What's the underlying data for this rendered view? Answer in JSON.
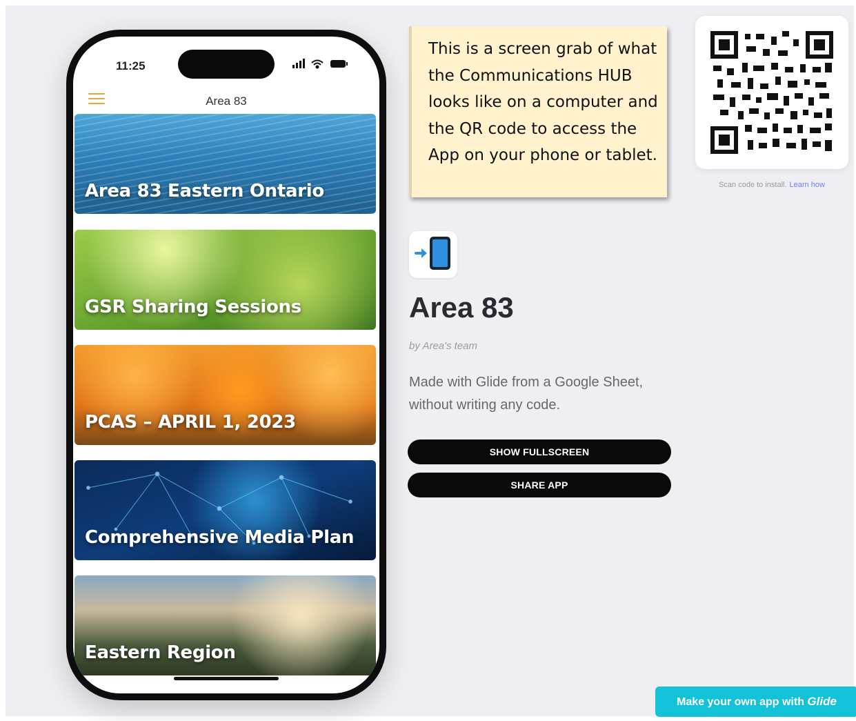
{
  "phone": {
    "status_time": "11:25",
    "header_title": "Area 83",
    "cards": [
      {
        "label": "Area 83 Eastern Ontario"
      },
      {
        "label": "GSR Sharing Sessions"
      },
      {
        "label": "PCAS – APRIL 1, 2023"
      },
      {
        "label": "Comprehensive Media Plan"
      },
      {
        "label": "Eastern Region"
      }
    ]
  },
  "note": {
    "text": "This is a screen grab of what the Communications HUB looks like on a computer and the QR code to access the App on your phone or tablet."
  },
  "qr": {
    "caption": "Scan code to install.",
    "link": "Learn how"
  },
  "app": {
    "title": "Area 83",
    "author": "by Area's team",
    "description": "Made with Glide from a Google Sheet, without writing any code.",
    "buttons": {
      "fullscreen": "SHOW FULLSCREEN",
      "share": "SHARE APP"
    }
  },
  "cta": {
    "prefix": "Make your own app with",
    "brand": "Glide"
  },
  "colors": {
    "menu_accent": "#e5a53a",
    "cta_background": "#13c2d9",
    "note_background": "#fff2cc"
  }
}
